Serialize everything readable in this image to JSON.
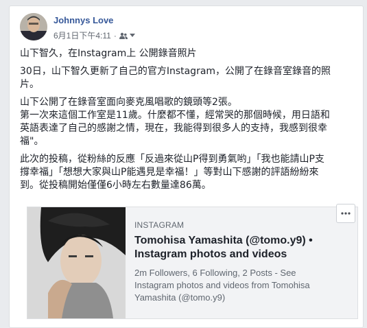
{
  "post": {
    "author": "Johnnys Love",
    "timestamp": "6月1日下午4:11",
    "separator": "·",
    "audience_icon": "friends-icon",
    "paragraphs": [
      [
        "山下智久，在Instagram上 公開錄音照片"
      ],
      [
        "30日，山下智久更新了自己的官方Instagram，公開了在錄音室錄音的照",
        "片。"
      ],
      [
        "山下公開了在錄音室面向麥克風唱歌的鏡頭等2張。",
        "第一次來這個工作室是11歲。什麼都不懂，經常哭的那個時候，用日語和",
        "英語表達了自己的感謝之情，現在，我能得到很多人的支持，我感到很幸",
        "福\"。"
      ],
      [
        "此次的投稿，從粉絲的反應「反過來從山P得到勇氣哟」「我也能請山P支",
        "撐幸福」「想想大家與山P能遇見是幸福！」等對山下感謝的評語紛紛來",
        "到。從投稿開始僅僅6小時左右數量達86萬。"
      ]
    ]
  },
  "link_preview": {
    "source": "INSTAGRAM",
    "title_lines": [
      "Tomohisa Yamashita (@tomo.y9) •",
      "Instagram photos and videos"
    ],
    "desc_lines": [
      "2m Followers, 6 Following, 2 Posts - See",
      "Instagram photos and videos from Tomohisa",
      "Yamashita (@tomo.y9)"
    ]
  },
  "colors": {
    "author": "#365899",
    "meta": "#616770",
    "text": "#1d2129",
    "card_bg": "#f2f3f5"
  }
}
